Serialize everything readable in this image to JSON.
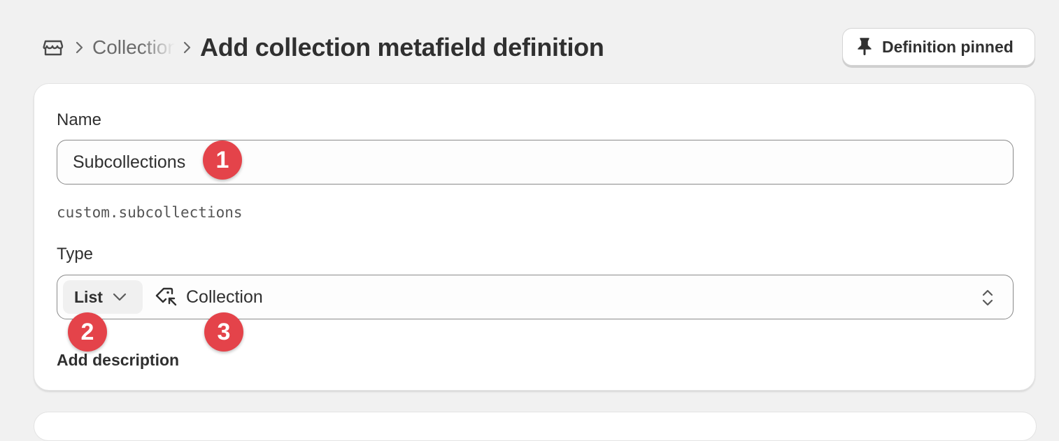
{
  "header": {
    "breadcrumb_parent": "Collections",
    "page_title": "Add collection metafield definition",
    "pin_button_label": "Definition pinned"
  },
  "form": {
    "name_label": "Name",
    "name_value": "Subcollections",
    "namespace_key": "custom.subcollections",
    "type_label": "Type",
    "list_label": "List",
    "type_value": "Collection",
    "add_description_label": "Add description"
  },
  "markers": [
    "1",
    "2",
    "3"
  ],
  "colors": {
    "background": "#f1f1f1",
    "card": "#ffffff",
    "marker": "#e4434a",
    "text": "#303030"
  },
  "icons": {
    "store": "store-icon",
    "breadcrumb_separator": "chevron-right-icon",
    "pin": "pin-icon",
    "list_dropdown": "chevron-down-icon",
    "collection": "collection-tag-icon",
    "select": "select-updown-icon"
  }
}
